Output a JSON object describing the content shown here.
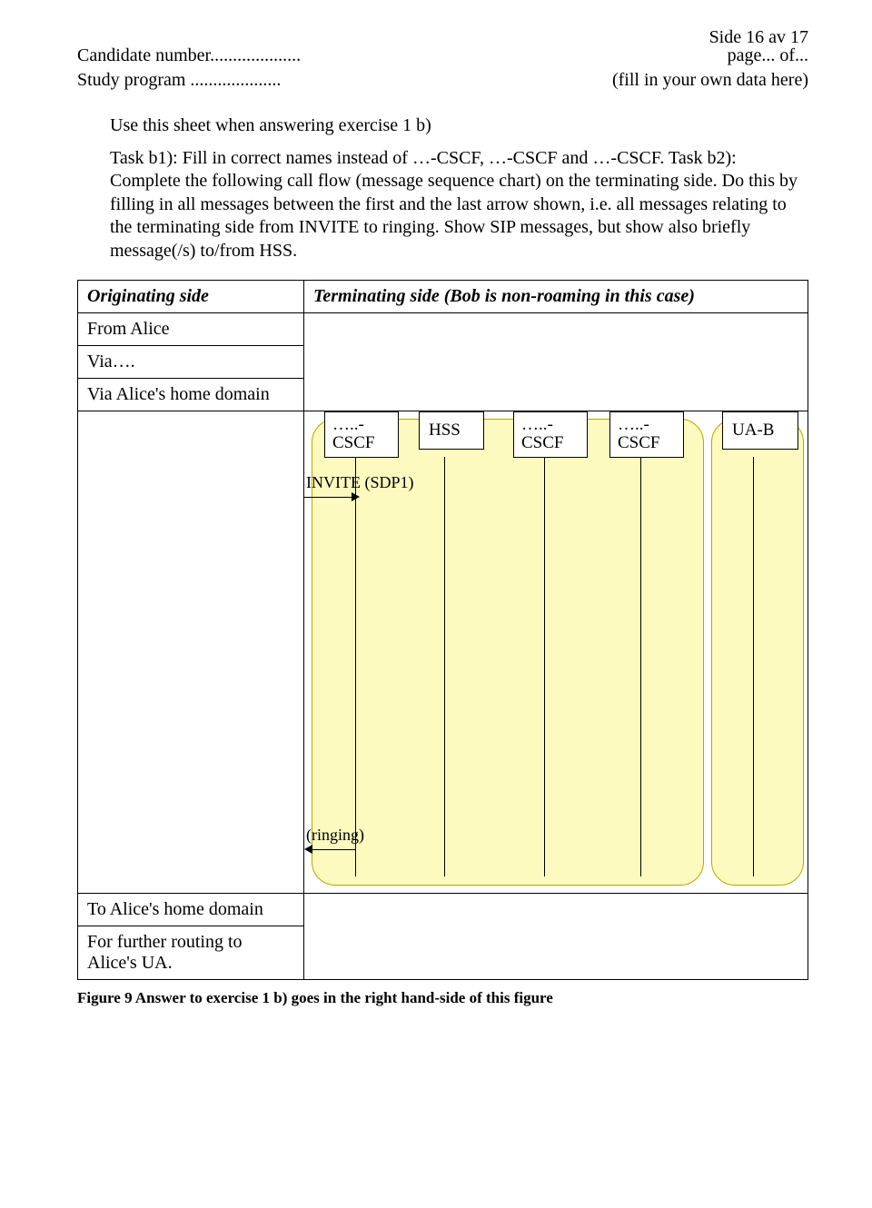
{
  "page_number_label": "Side 16 av 17",
  "header": {
    "candidate_label": "Candidate number....................",
    "page_of": "page... of...",
    "study_label": "Study program ....................",
    "fill_hint": "(fill in your own data here)"
  },
  "instructions": {
    "lead": "Use this sheet when answering exercise 1 b)",
    "body": "Task b1): Fill in correct names instead of …-CSCF, …-CSCF and …-CSCF. Task b2): Complete the following call flow (message sequence chart) on the terminating side. Do this by filling in all messages between the first and the last arrow shown, i.e. all messages relating to the terminating side from INVITE to ringing. Show SIP messages, but show also briefly message(/s) to/from HSS."
  },
  "table": {
    "orig_header": "Originating side",
    "term_header": "Terminating side (Bob is non-roaming in this case)",
    "from_alice": "From Alice",
    "via": "Via….",
    "via_home": "Via Alice's home domain",
    "to_home": "To Alice's home domain",
    "further": "For further routing to Alice's UA."
  },
  "nodes": {
    "cscf1": "…..-\nCSCF",
    "hss": "HSS",
    "cscf2": "…..-\nCSCF",
    "cscf3": "…..-\nCSCF",
    "uab": "UA-B"
  },
  "messages": {
    "invite": "INVITE (SDP1)",
    "ringing": "(ringing)"
  },
  "figure_caption": "Figure 9 Answer to exercise 1 b) goes in the right hand-side of this figure"
}
